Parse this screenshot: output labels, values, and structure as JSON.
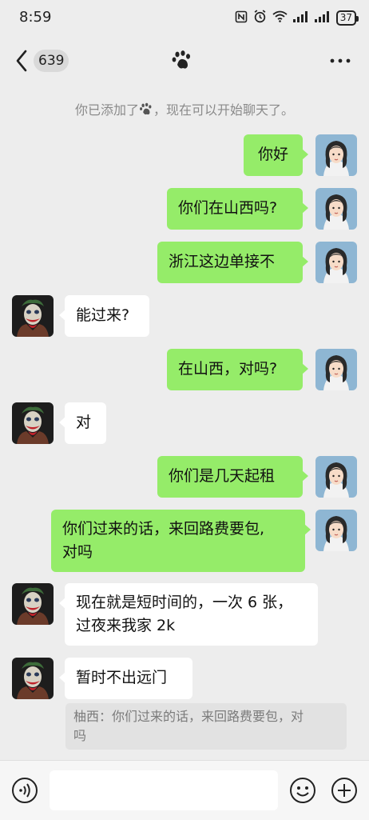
{
  "status_bar": {
    "time": "8:59",
    "battery": "37",
    "icons": [
      "nfc-icon",
      "alarm-icon",
      "wifi-icon",
      "signal-icon",
      "signal-icon",
      "battery-icon"
    ]
  },
  "header": {
    "back_icon": "chevron-left-icon",
    "unread_count": "639",
    "title_icon": "paw-icon",
    "more_icon": "more-icon"
  },
  "system_note": {
    "before": "你已添加了",
    "after": "，现在可以开始聊天了。"
  },
  "messages": [
    {
      "from": "me",
      "text": "你好"
    },
    {
      "from": "me",
      "text": "你们在山西吗?"
    },
    {
      "from": "me",
      "text": "浙江这边单接不"
    },
    {
      "from": "other",
      "text": "能过来?"
    },
    {
      "from": "me",
      "text": "在山西，对吗?"
    },
    {
      "from": "other",
      "text": "对"
    },
    {
      "from": "me",
      "text": "你们是几天起租"
    },
    {
      "from": "me",
      "line1": "你们过来的话，来回路费要包,",
      "line2": "对吗"
    },
    {
      "from": "other",
      "line1": "现在就是短时间的，一次 6 张，",
      "line2": "过夜来我家 2k"
    },
    {
      "from": "other",
      "text": "暂时不出远门"
    }
  ],
  "quote": {
    "line1": "柚西：你们过来的话，来回路费要包，对",
    "line2": "吗"
  },
  "input_bar": {
    "voice_icon": "voice-icon",
    "input_value": "",
    "emoji_icon": "emoji-icon",
    "plus_icon": "plus-icon"
  },
  "colors": {
    "background": "#ededed",
    "my_bubble": "#95ec69",
    "their_bubble": "#ffffff"
  }
}
